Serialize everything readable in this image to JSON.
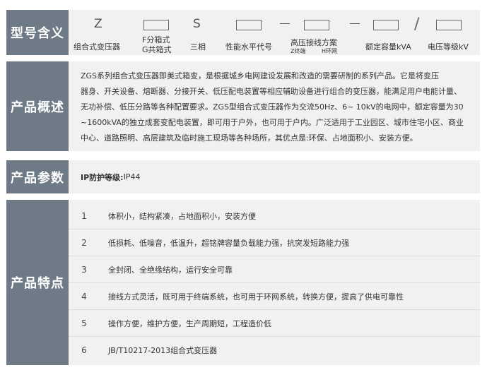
{
  "model": {
    "label": "型号含义",
    "codes": [
      "Z",
      "S"
    ],
    "captions": {
      "combined": "组合式变压器",
      "box_f": "F分箱式",
      "box_g": "G共箱式",
      "three_phase": "三相",
      "performance": "性能水平代号",
      "hv_scheme": "高压接线方案",
      "hv_z": "Z终端",
      "hv_h": "H环网",
      "capacity": "额定容量kVA",
      "voltage": "电压等级kV"
    }
  },
  "overview": {
    "label": "产品概述",
    "lines": [
      "ZGS系列组合式变压器即美式箱变，是根据城乡电网建设发展和改造的需要研制的系列产品。它是将变压",
      "器身、开关设备、熔断器、分接开关、低压配电装置等相应辅助设备进行组合的变压器，能满足用户电能计量、",
      "无功补偿、低压分路等各种配置要求。ZGS型组合式变压器作为交流50Hz、6~ 10kV的电网中，额定容量为30",
      "~1600kVA的独立成套变配电装置，即可用于户外，也可用于户内。广泛适用于工业园区、城市住宅小区、商业",
      "中心、道路照明、高层建筑及临时施工现场等各种场所，其优点是:环保、占地面积小、安装方便。"
    ]
  },
  "params": {
    "label": "产品参数",
    "key": "IP防护等级:",
    "value": "IP44"
  },
  "features": {
    "label": "产品特点",
    "items": [
      {
        "num": "1",
        "text": "体积小，结构紧凑，占地面积小，安装方便"
      },
      {
        "num": "2",
        "text": "低损耗、低噪音，低温升，超铭牌容量负载能力强，抗突发短路能力强"
      },
      {
        "num": "3",
        "text": "全封闭、全绝缘结构，运行安全可靠"
      },
      {
        "num": "4",
        "text": "接线方式灵活，既可用于终端系统，也可用于环网系统，转换方便，提高了供电可靠性"
      },
      {
        "num": "5",
        "text": "操作方便，维护方便，生产周期短，工程造价低"
      },
      {
        "num": "6",
        "text": "JB/T10217-2013组合式变压器"
      }
    ]
  }
}
